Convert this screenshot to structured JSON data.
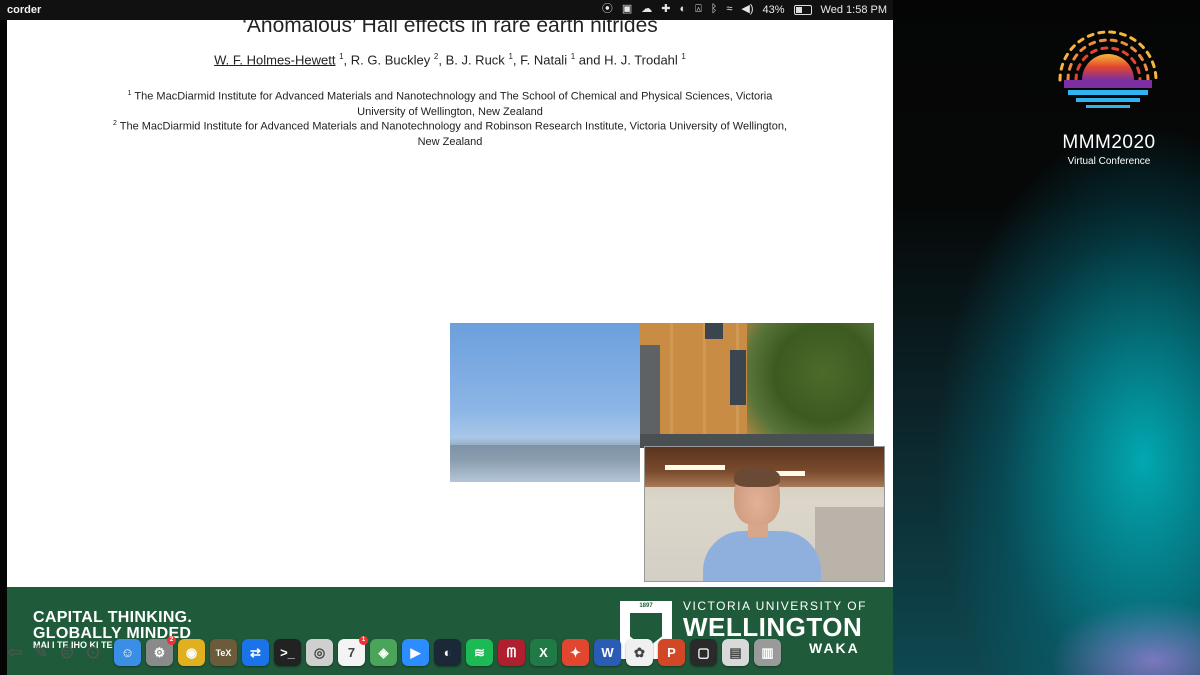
{
  "menubar": {
    "app_name": "corder",
    "battery_percent": "43%",
    "battery_level": 0.43,
    "clock": "Wed 1:58 PM"
  },
  "slide": {
    "title": "‘Anomalous’ Hall effects in rare earth nitrides",
    "authors": [
      {
        "name": "W. F. Holmes-Hewett",
        "sup": "1"
      },
      {
        "name": "R. G. Buckley",
        "sup": "2"
      },
      {
        "name": "B. J. Ruck",
        "sup": "1"
      },
      {
        "name": "F. Natali",
        "sup": "1"
      },
      {
        "name": "H. J. Trodahl",
        "sup": "1"
      }
    ],
    "affiliations": [
      {
        "sup": "1",
        "text": "The MacDiarmid Institute for Advanced Materials and Nanotechnology and The School of Chemical and Physical Sciences, Victoria University of Wellington, New Zealand"
      },
      {
        "sup": "2",
        "text": "The MacDiarmid Institute for Advanced Materials and Nanotechnology and Robinson Research Institute, Victoria University of Wellington, New Zealand"
      }
    ]
  },
  "footer": {
    "tagline_1": "CAPITAL THINKING.",
    "tagline_2": "GLOBALLY MINDED",
    "tagline_3": "MAI I TE IHO KI TE PAE",
    "crest_year": "1897",
    "uni_line_1": "VICTORIA UNIVERSITY OF",
    "uni_line_2": "WELLINGTON",
    "uni_line_3": "WAKA"
  },
  "conference": {
    "title": "MMM2020",
    "subtitle": "Virtual Conference"
  },
  "dock": {
    "apps": [
      {
        "name": "finder",
        "glyph": "☺",
        "color": "#3a8ee6"
      },
      {
        "name": "system-preferences",
        "glyph": "⚙",
        "color": "#8a8a8a",
        "badge": "2"
      },
      {
        "name": "chrome",
        "glyph": "◉",
        "color": "#e0b020"
      },
      {
        "name": "texmaker",
        "glyph": "TeX",
        "color": "#6b5b3a"
      },
      {
        "name": "teamviewer",
        "glyph": "⇄",
        "color": "#1a73e8"
      },
      {
        "name": "terminal",
        "glyph": ">_",
        "color": "#222222"
      },
      {
        "name": "screenshot",
        "glyph": "◎",
        "color": "#cfcfcf"
      },
      {
        "name": "calendar",
        "glyph": "7",
        "color": "#f4f4f4",
        "badge": "1"
      },
      {
        "name": "maps",
        "glyph": "◈",
        "color": "#4aa55a"
      },
      {
        "name": "zoom",
        "glyph": "▶",
        "color": "#2d8cff"
      },
      {
        "name": "steam",
        "glyph": "◐",
        "color": "#1b2838"
      },
      {
        "name": "spotify",
        "glyph": "≋",
        "color": "#1db954"
      },
      {
        "name": "mendeley",
        "glyph": "ᗰ",
        "color": "#b01f2e"
      },
      {
        "name": "excel",
        "glyph": "X",
        "color": "#1f7a45"
      },
      {
        "name": "acrobat",
        "glyph": "✦",
        "color": "#e2462f"
      },
      {
        "name": "word",
        "glyph": "W",
        "color": "#2b5cb5"
      },
      {
        "name": "photos",
        "glyph": "✿",
        "color": "#f0f0f0"
      },
      {
        "name": "powerpoint",
        "glyph": "P",
        "color": "#d24726"
      },
      {
        "name": "screen-recorder",
        "glyph": "▢",
        "color": "#2a2a2a"
      },
      {
        "name": "documents",
        "glyph": "▤",
        "color": "#d9d9d9"
      },
      {
        "name": "trash",
        "glyph": "▥",
        "color": "#9a9a9a"
      }
    ]
  }
}
